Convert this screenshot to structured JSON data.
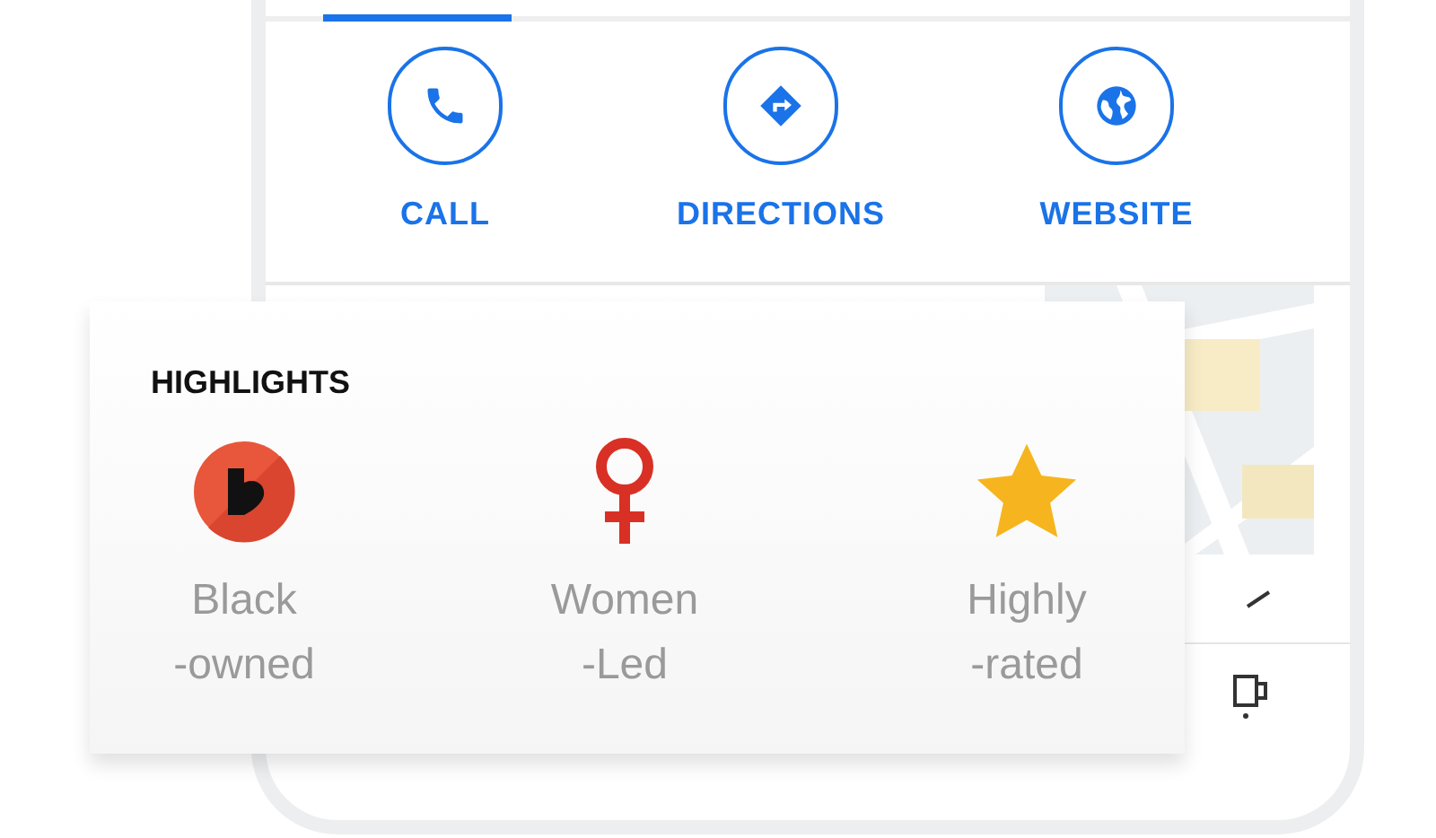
{
  "actions": [
    {
      "label": "CALL"
    },
    {
      "label": "DIRECTIONS"
    },
    {
      "label": "WEBSITE"
    }
  ],
  "highlights": {
    "title": "HIGHLIGHTS",
    "items": [
      {
        "line1": "Black",
        "line2": "-owned"
      },
      {
        "line1": "Women",
        "line2": "-Led"
      },
      {
        "line1": "Highly",
        "line2": "-rated"
      }
    ]
  }
}
